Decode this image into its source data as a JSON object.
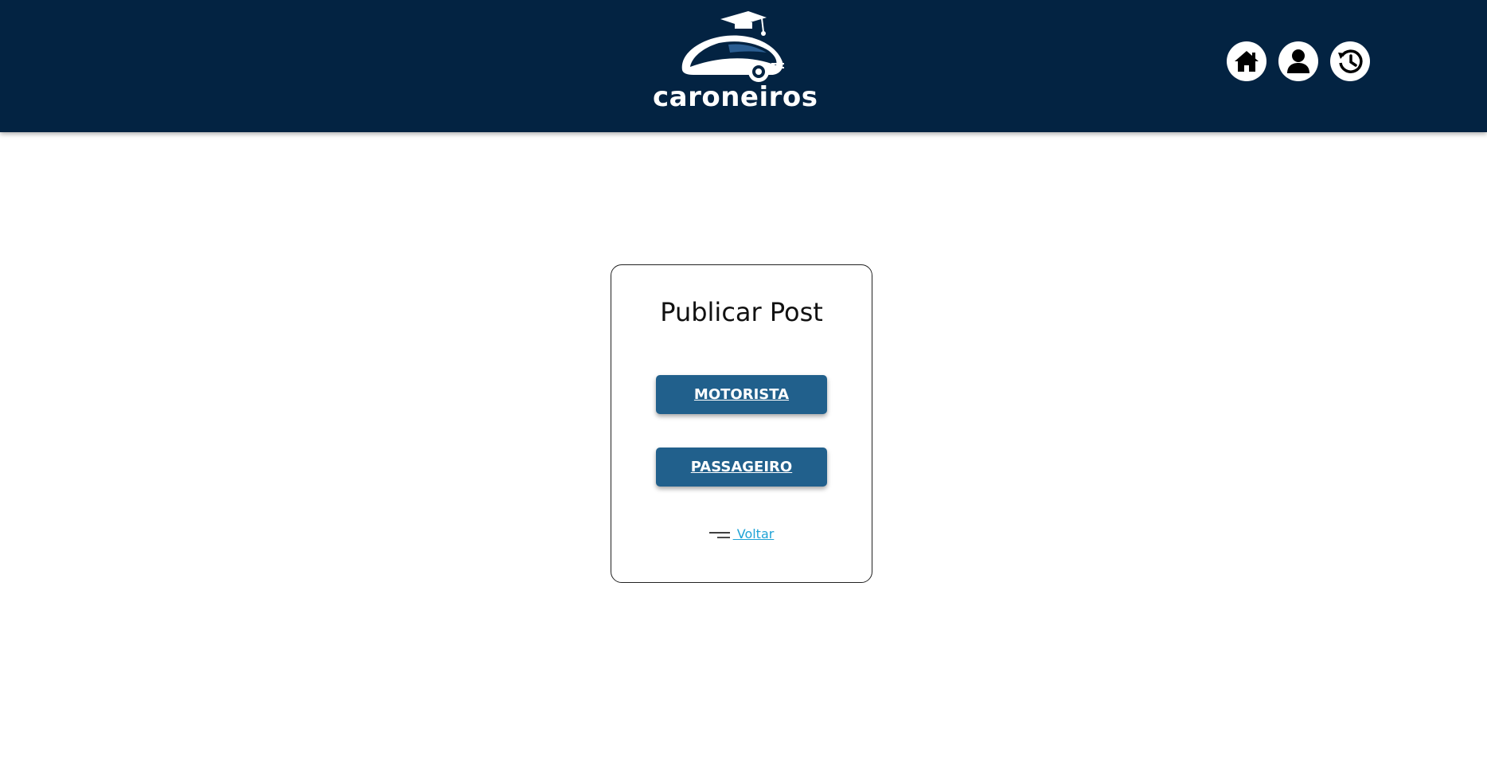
{
  "header": {
    "brand": "caroneiros",
    "nav": [
      {
        "icon": "home-icon"
      },
      {
        "icon": "user-icon"
      },
      {
        "icon": "history-icon"
      }
    ]
  },
  "card": {
    "title": "Publicar Post",
    "buttons": {
      "motorista": "MOTORISTA",
      "passageiro": "PASSAGEIRO"
    },
    "back_label": " Voltar",
    "back_icon": "menu-lines-icon"
  },
  "colors": {
    "header_bg": "#032342",
    "button_bg": "#21608c",
    "link": "#1fa3d6"
  }
}
